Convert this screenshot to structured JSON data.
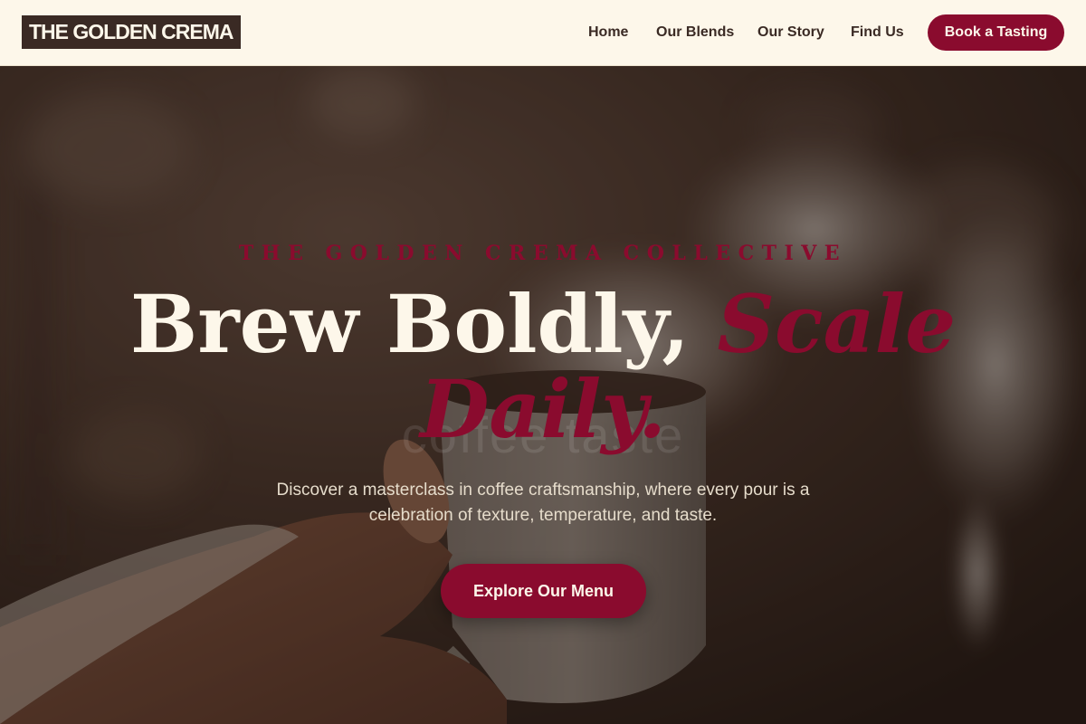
{
  "header": {
    "logo": "THE GOLDEN CREMA",
    "nav": [
      "Home",
      "Our Blends",
      "Our Story",
      "Find Us"
    ],
    "cta": "Book a Tasting"
  },
  "hero": {
    "eyebrow": "THE GOLDEN CREMA COLLECTIVE",
    "headline_plain": "Brew Boldly, ",
    "headline_accent": "Scale Daily.",
    "ghost_text": "coffee taste",
    "subtitle": "Discover a masterclass in coffee craftsmanship, where every pour is a celebration of texture, temperature, and taste.",
    "cta": "Explore Our Menu"
  },
  "colors": {
    "accent": "#8a0b2e",
    "cream": "#fdf7ea",
    "dark": "#3a2a24"
  }
}
